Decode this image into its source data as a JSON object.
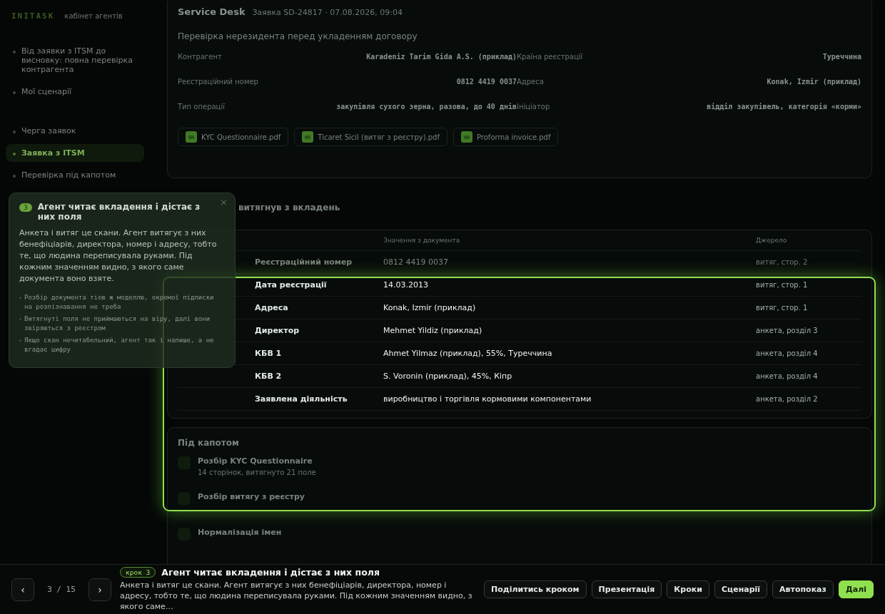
{
  "sidebar": {
    "logo": "INITASK",
    "subtitle": "кабінет агентів",
    "scenarios": [
      {
        "label": "Від заявки з ITSM до висновку: повна перевірка контрагента"
      },
      {
        "label": "Мої сценарії"
      }
    ],
    "steps": [
      {
        "label": "Черга заявок",
        "selected": false
      },
      {
        "label": "Заявка з ITSM",
        "selected": true
      },
      {
        "label": "Перевірка під капотом",
        "selected": false
      }
    ]
  },
  "ticket": {
    "source": "Service Desk",
    "meta": "Заявка SD-24817 · 07.08.2026, 09:04",
    "title": "Перевірка нерезидента перед укладенням договору",
    "fields": [
      {
        "label": "Контрагент",
        "value": "Karadeniz Tarim Gida A.S. (приклад)"
      },
      {
        "label": "Країна реєстрації",
        "value": "Туреччина"
      },
      {
        "label": "Реєстраційний номер",
        "value": "0812 4419 0037"
      },
      {
        "label": "Адреса",
        "value": "Konak, Izmir (приклад)"
      },
      {
        "label": "Тип операції",
        "value": "закупівля сухого зерна, разова, до 40 днів"
      },
      {
        "label": "Ініціатор",
        "value": "відділ закупівель, категорія «корми»"
      }
    ],
    "attachments": [
      {
        "name": "KYC Questionnaire.pdf"
      },
      {
        "name": "Ticaret Sicil (витяг з реєстру).pdf"
      },
      {
        "name": "Proforma invoice.pdf"
      }
    ]
  },
  "extraction": {
    "title": "витягнув з вкладень",
    "columns": [
      "Значення з документа",
      "Джерело"
    ],
    "rows": [
      {
        "field": "Реєстраційний номер",
        "value": "0812 4419 0037",
        "source": "витяг, стор. 2",
        "highlighted": false
      },
      {
        "field": "Дата реєстрації",
        "value": "14.03.2013",
        "source": "витяг, стор. 1",
        "highlighted": true
      },
      {
        "field": "Адреса",
        "value": "Konak, Izmir (приклад)",
        "source": "витяг, стор. 1",
        "highlighted": true
      },
      {
        "field": "Директор",
        "value": "Mehmet Yildiz (приклад)",
        "source": "анкета, розділ 3",
        "highlighted": true
      },
      {
        "field": "КБВ 1",
        "value": "Ahmet Yilmaz (приклад), 55%, Туреччина",
        "source": "анкета, розділ 4",
        "highlighted": true
      },
      {
        "field": "КБВ 2",
        "value": "S. Voronin (приклад), 45%, Кіпр",
        "source": "анкета, розділ 4",
        "highlighted": true
      },
      {
        "field": "Заявлена діяльність",
        "value": "виробництво і торгівля кормовими компонентами",
        "source": "анкета, розділ 2",
        "highlighted": true
      }
    ]
  },
  "under_hood": {
    "title": "Під капотом",
    "items": [
      {
        "title": "Розбір KYC Questionnaire",
        "detail": "14 сторінок, витягнуто 21 поле"
      },
      {
        "title": "Розбір витягу з реєстру"
      },
      {
        "title": "Нормалізація імен"
      }
    ]
  },
  "tooltip": {
    "step": "3",
    "title": "Агент читає вкладення і дістає з них поля",
    "close": "×",
    "body": "Анкета і витяг це скани. Агент витягує з них бенефіціарів, директора, номер і адресу, тобто те, що людина переписувала руками. Під кожним значенням видно, з якого саме документа воно взяте.",
    "bullets": [
      "Розбір документа тією ж моделлю, окремої підписки на розпізнавання не треба",
      "Витягнуті поля не приймаються на віру, далі вони звіряються з реєстром",
      "Якщо скан нечитабельний, агент так і напише, а не вгадає цифру"
    ]
  },
  "footer": {
    "prev": "‹",
    "next": "›",
    "counter": "3 / 15",
    "badge": "крок 3",
    "title": "Агент читає вкладення і дістає з них поля",
    "description": "Анкета і витяг це скани. Агент витягує з них бенефіціарів, директора, номер і адресу, тобто те, що людина переписувала руками. Під кожним значенням видно, з якого саме…",
    "buttons": [
      {
        "label": "Поділитись кроком",
        "kind": "secondary"
      },
      {
        "label": "Презентація",
        "kind": "secondary"
      },
      {
        "label": "Кроки",
        "kind": "secondary"
      },
      {
        "label": "Сценарії",
        "kind": "secondary"
      },
      {
        "label": "Автопоказ",
        "kind": "secondary"
      },
      {
        "label": "Далі",
        "kind": "primary"
      }
    ]
  }
}
